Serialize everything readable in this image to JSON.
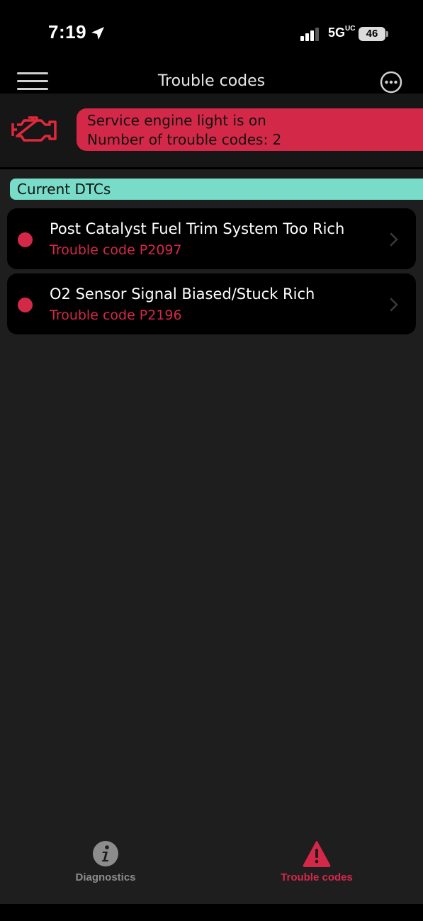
{
  "status_bar": {
    "time": "7:19",
    "network": "5G",
    "network_suffix": "UC",
    "battery": "46"
  },
  "nav": {
    "title": "Trouble codes"
  },
  "banner": {
    "line1": "Service engine light is on",
    "line2": "Number of trouble codes:  2",
    "accent_color": "#d42848"
  },
  "section": {
    "header": "Current DTCs",
    "color": "#78dcc8"
  },
  "dtcs": [
    {
      "title": "Post Catalyst Fuel Trim System Too Rich",
      "code": "Trouble code P2097"
    },
    {
      "title": "O2 Sensor Signal Biased/Stuck Rich",
      "code": "Trouble code P2196"
    }
  ],
  "tabs": [
    {
      "label": "Diagnostics",
      "icon": "info-icon",
      "active": false
    },
    {
      "label": "Trouble codes",
      "icon": "warning-icon",
      "active": true
    }
  ]
}
